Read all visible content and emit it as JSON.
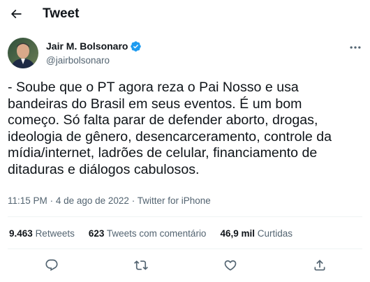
{
  "header": {
    "title": "Tweet",
    "back_icon": "arrow-left-icon"
  },
  "author": {
    "display_name": "Jair M. Bolsonaro",
    "handle": "@jairbolsonaro",
    "verified_icon": "verified-badge-icon",
    "more_icon": "more-horizontal-icon"
  },
  "tweet": {
    "text": "- Soube que o PT agora reza o Pai Nosso e usa\nbandeiras do Brasil em seus eventos. É um bom\ncomeço. Só falta parar de defender aborto, drogas,\nideologia de gênero, desencarceramento, controle da\nmídia/internet, ladrões de celular, financiamento de\nditaduras e diálogos cabulosos.",
    "time": "11:15 PM",
    "separator": "·",
    "date": "4 de ago de 2022",
    "source": "Twitter for iPhone"
  },
  "stats": {
    "retweets_count": "9.463",
    "retweets_label": "Retweets",
    "quotes_count": "623",
    "quotes_label": "Tweets com comentário",
    "likes_count": "46,9 mil",
    "likes_label": "Curtidas"
  },
  "actions": [
    {
      "icon": "reply-icon"
    },
    {
      "icon": "retweet-icon"
    },
    {
      "icon": "like-icon"
    },
    {
      "icon": "share-icon"
    }
  ],
  "colors": {
    "text": "#0f1419",
    "secondary": "#536471",
    "verified": "#1d9bf0",
    "divider": "#eff3f4"
  }
}
